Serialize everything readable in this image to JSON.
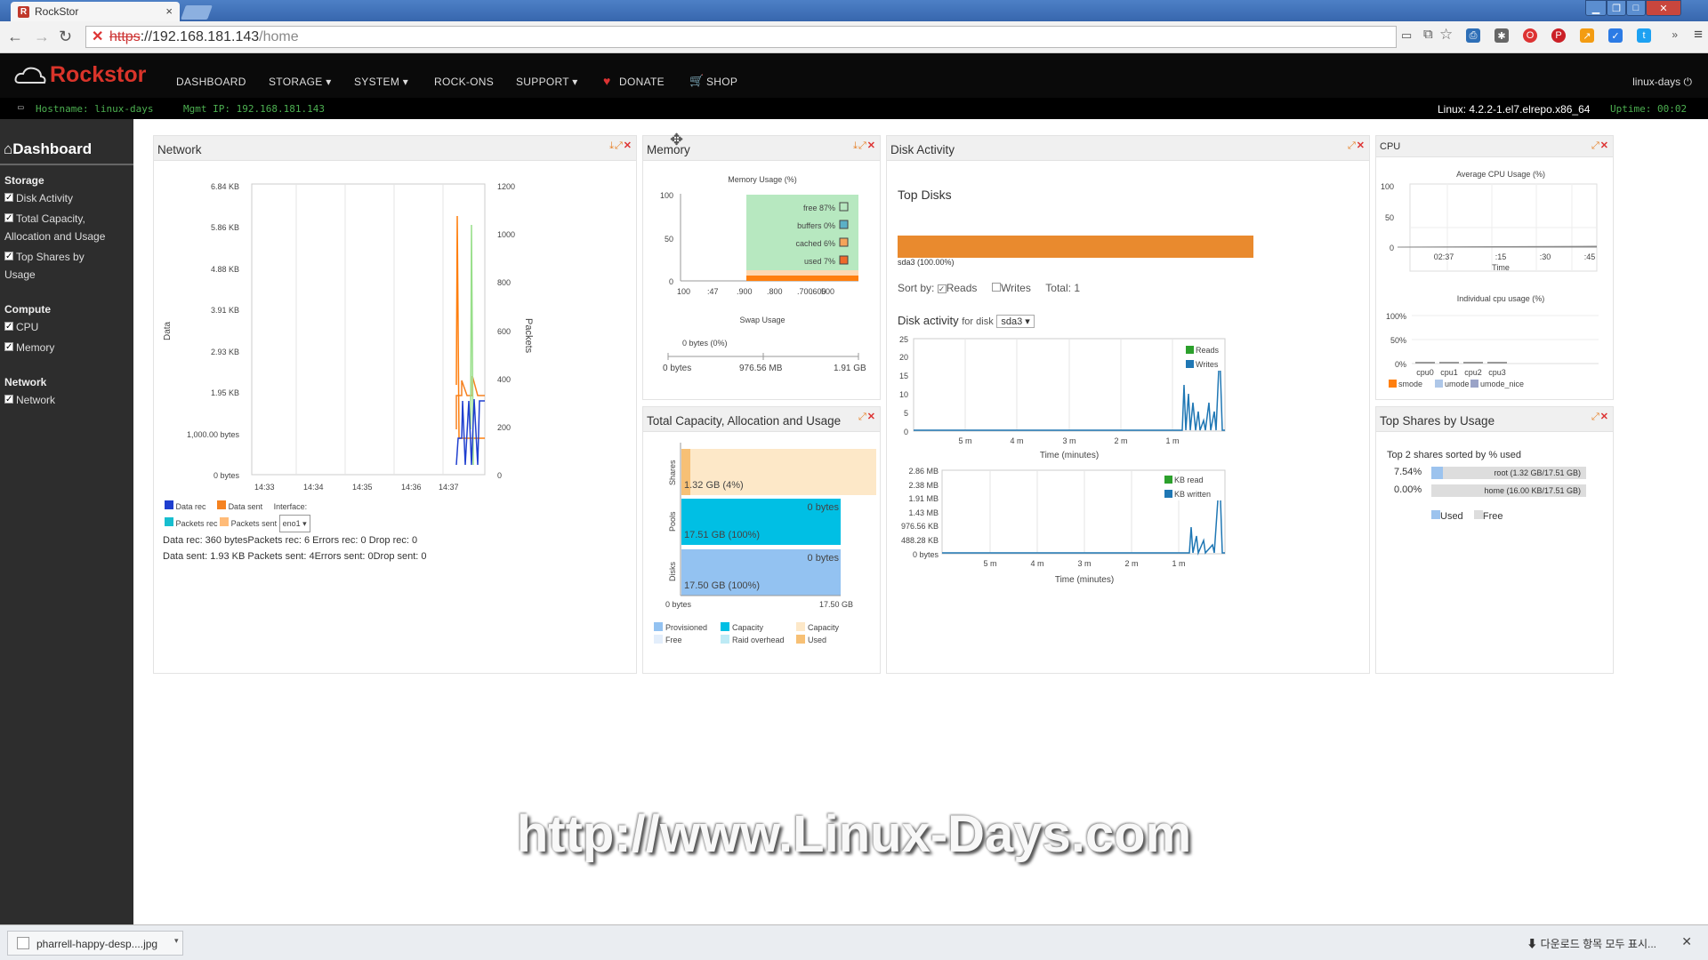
{
  "browser": {
    "tab_title": "RockStor",
    "url_scheme": "https",
    "url_host": "://192.168.181.143",
    "url_path": "/home"
  },
  "app": {
    "brand": "Rockstor",
    "menu": [
      "DASHBOARD",
      "STORAGE ▾",
      "SYSTEM ▾",
      "ROCK-ONS",
      "SUPPORT ▾",
      "DONATE",
      "SHOP"
    ],
    "user": "linux-days",
    "hostname": "Hostname: linux-days",
    "mgmt_ip": "Mgmt IP: 192.168.181.143",
    "kernel": "Linux: 4.2.2-1.el7.elrepo.x86_64",
    "uptime": "Uptime: 00:02"
  },
  "sidebar": {
    "title": "Dashboard",
    "groups": [
      {
        "label": "Storage",
        "items": [
          "Disk Activity",
          "Total Capacity,",
          "Allocation and Usage",
          "Top Shares by",
          "Usage"
        ]
      },
      {
        "label": "Compute",
        "items": [
          "CPU",
          "Memory"
        ]
      },
      {
        "label": "Network",
        "items": [
          "Network"
        ]
      }
    ]
  },
  "network": {
    "title": "Network",
    "y_left": [
      "6.84 KB",
      "5.86 KB",
      "4.88 KB",
      "3.91 KB",
      "2.93 KB",
      "1.95 KB",
      "1,000.00 bytes",
      "0 bytes"
    ],
    "y_right": [
      "1200",
      "1000",
      "800",
      "600",
      "400",
      "200",
      "0"
    ],
    "x": [
      "14:33",
      "14:34",
      "14:35",
      "14:36",
      "14:37"
    ],
    "ylabel_left": "Data",
    "ylabel_right": "Packets",
    "legend": [
      "Data rec",
      "Data sent",
      "Packets rec",
      "Packets sent"
    ],
    "interface_label": "Interface:",
    "interface": "eno1",
    "stats1": "Data rec: 360 bytesPackets rec: 6 Errors rec: 0 Drop rec: 0",
    "stats2": "Data sent: 1.93 KB Packets sent: 4Errors sent: 0Drop sent: 0"
  },
  "memory": {
    "title": "Memory",
    "chart_title": "Memory Usage (%)",
    "y": [
      "100",
      "50",
      "0"
    ],
    "x": [
      "100",
      ":47",
      ".900",
      ".800",
      ".700",
      ".600",
      "500"
    ],
    "legend": [
      {
        "label": "free 87%",
        "color": "#6fd08a"
      },
      {
        "label": "buffers 0%",
        "color": "#1f77b4"
      },
      {
        "label": "cached 6%",
        "color": "#ffbb78"
      },
      {
        "label": "used 7%",
        "color": "#ff7f0e"
      }
    ],
    "swap_title": "Swap Usage",
    "swap_value": "0 bytes (0%)",
    "swap_ticks": [
      "0 bytes",
      "976.56 MB",
      "1.91 GB"
    ]
  },
  "capacity": {
    "title": "Total Capacity, Allocation and Usage",
    "rows": [
      "Shares",
      "Pools",
      "Disks"
    ],
    "shares_label": "1.32 GB (4%)",
    "pools_free": "0 bytes",
    "pools_label": "17.51 GB (100%)",
    "disks_free": "0 bytes",
    "disks_label": "17.50 GB (100%)",
    "ticks": [
      "0 bytes",
      "17.50 GB"
    ],
    "legend": [
      "Provisioned",
      "Capacity",
      "Capacity",
      "Free",
      "Raid overhead",
      "Used"
    ]
  },
  "disk": {
    "title": "Disk Activity",
    "top_title": "Top Disks",
    "bar_label": "sda3 (100.00%)",
    "sort_by": "Sort by:",
    "reads": "Reads",
    "writes": "Writes",
    "total": "Total: 1",
    "activity_label": "Disk activity",
    "for_disk": "for disk",
    "disk_select": "sda3",
    "chart1_y": [
      "25",
      "20",
      "15",
      "10",
      "5",
      "0"
    ],
    "chart1_legend": [
      "Reads",
      "Writes"
    ],
    "chart2_y": [
      "2.86 MB",
      "2.38 MB",
      "1.91 MB",
      "1.43 MB",
      "976.56 KB",
      "488.28 KB",
      "0 bytes"
    ],
    "chart2_legend": [
      "KB read",
      "KB written"
    ],
    "x": [
      "5 m",
      "4 m",
      "3 m",
      "2 m",
      "1 m"
    ],
    "xlabel": "Time (minutes)"
  },
  "cpu": {
    "title": "CPU",
    "avg_title": "Average CPU Usage (%)",
    "avg_y": [
      "100",
      "50",
      "0"
    ],
    "avg_x": [
      "02:37",
      ":15",
      ":30",
      ":45"
    ],
    "avg_xlabel": "Time",
    "ind_title": "Individual cpu usage (%)",
    "ind_y": [
      "100%",
      "50%",
      "0%"
    ],
    "cpus": [
      "cpu0",
      "cpu1",
      "cpu2",
      "cpu3"
    ],
    "legend": [
      "smode",
      "umode",
      "umode_nice"
    ]
  },
  "shares": {
    "title": "Top Shares by Usage",
    "subtitle": "Top 2 shares sorted by % used",
    "rows": [
      {
        "pct": "7.54%",
        "label": "root (1.32 GB/17.51 GB)",
        "fill": 0.0754
      },
      {
        "pct": "0.00%",
        "label": "home (16.00 KB/17.51 GB)",
        "fill": 0
      }
    ],
    "legend": [
      "Used",
      "Free"
    ]
  },
  "download": {
    "file": "pharrell-happy-desp....jpg",
    "show_all": "다운로드 항목 모두 표시..."
  },
  "watermark": "http://www.Linux-Days.com"
}
